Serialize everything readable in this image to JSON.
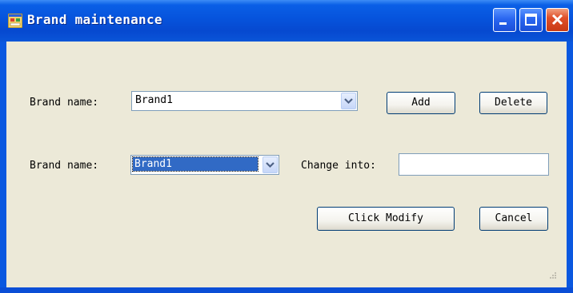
{
  "window": {
    "title": "Brand maintenance",
    "app_icon": "form-app-icon",
    "controls": [
      "minimize-icon",
      "maximize-icon",
      "close-icon"
    ]
  },
  "add_row": {
    "label": "Brand name:",
    "combo_value": "Brand1",
    "add_button": "Add",
    "delete_button": "Delete"
  },
  "modify_row": {
    "label": "Brand name:",
    "combo_value": "Brand1",
    "change_label": "Change into:",
    "change_value": ""
  },
  "actions": {
    "modify_button": "Click Modify",
    "cancel_button": "Cancel"
  },
  "colors": {
    "titlebar": "#0653dc",
    "client": "#ece9d8",
    "selection": "#316ac5",
    "close_button": "#e0502a"
  }
}
